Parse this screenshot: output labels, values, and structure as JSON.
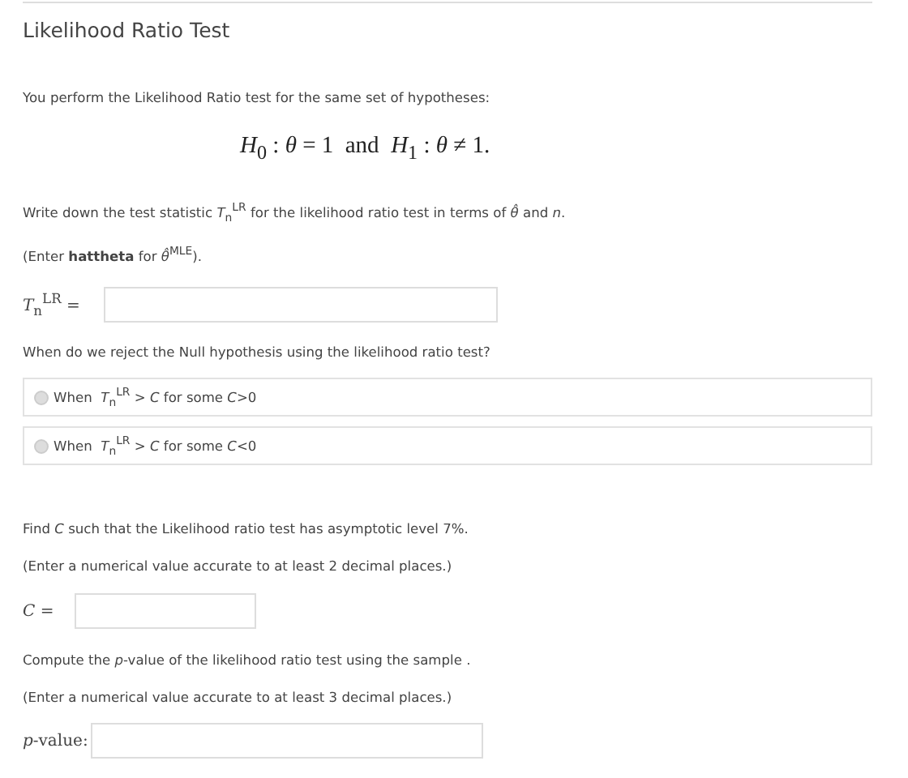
{
  "title": "Likelihood Ratio Test",
  "intro": "You perform the Likelihood Ratio test for the same set of hypotheses:",
  "equation": "*H*$_{0}$ : *θ* = 1  and  *H*$_{1}$ : *θ* ≠ 1.",
  "q1": {
    "prompt": "Write down the test statistic *T*$_{n}$$^{LR}$ for the likelihood ratio test in terms of *θ̂* and *n*.",
    "hint": "(Enter **hattheta** for *θ̂*$^{MLE}$).",
    "label": "*T*$_{n}$$^{LR}$ ="
  },
  "q2": {
    "prompt": "When do we reject the Null hypothesis using the likelihood ratio test?",
    "options": [
      {
        "text": "When  *T*$_{n}$$^{LR}$ > *C* for some *C*>0",
        "selected": false
      },
      {
        "text": "When  *T*$_{n}$$^{LR}$ > *C* for some *C*<0",
        "selected": false
      }
    ]
  },
  "q3": {
    "prompt": "Find *C* such that the Likelihood ratio test has asymptotic level 7%.",
    "hint": "(Enter a numerical value accurate to at least 2 decimal places.)",
    "label": "*C* ="
  },
  "q4": {
    "prompt": "Compute the *p*-value of the likelihood ratio test using the  sample .",
    "hint": "(Enter a numerical value accurate to at least 3 decimal places.)",
    "label": "*p*-value:"
  }
}
